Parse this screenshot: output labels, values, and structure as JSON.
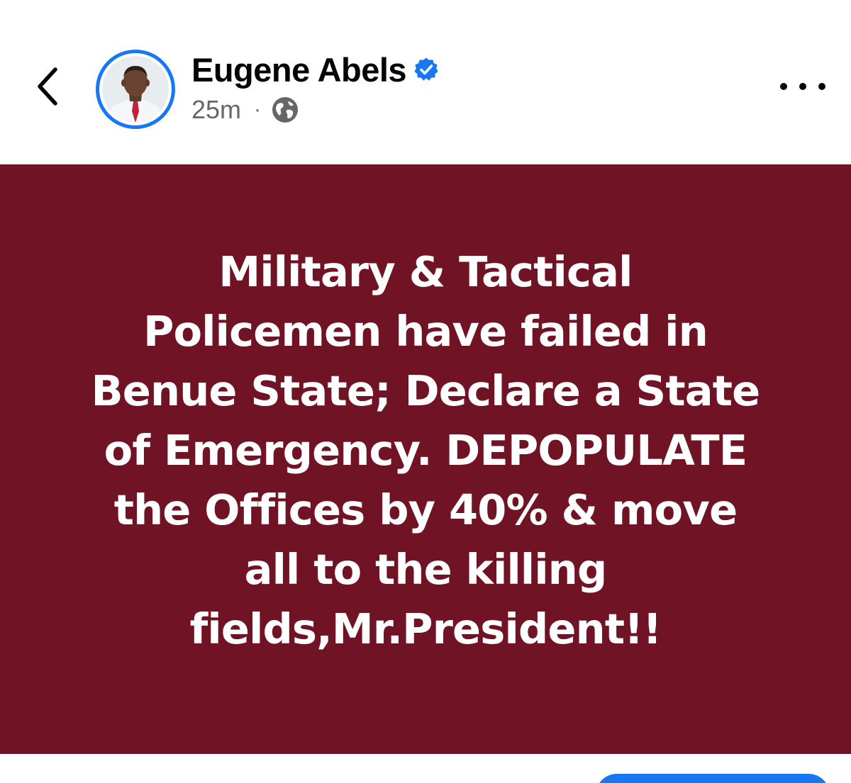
{
  "header": {
    "back_icon": "chevron-left-icon",
    "author": {
      "name": "Eugene Abels",
      "verified": true,
      "verified_icon": "verified-badge-icon"
    },
    "meta": {
      "time": "25m",
      "separator": "·",
      "audience_icon": "globe-icon"
    },
    "more_icon": "more-horizontal-icon"
  },
  "post": {
    "background_color": "#701324",
    "text_color": "#ffffff",
    "text": "Military & Tactical\nPolicemen have failed in\nBenue State; Declare a State\nof Emergency. DEPOPULATE\nthe  Offices by 40% & move\nall to the killing\nfields,Mr.President!!"
  },
  "colors": {
    "accent": "#1877f2",
    "name_text": "#050505",
    "meta_text": "#65676b"
  }
}
